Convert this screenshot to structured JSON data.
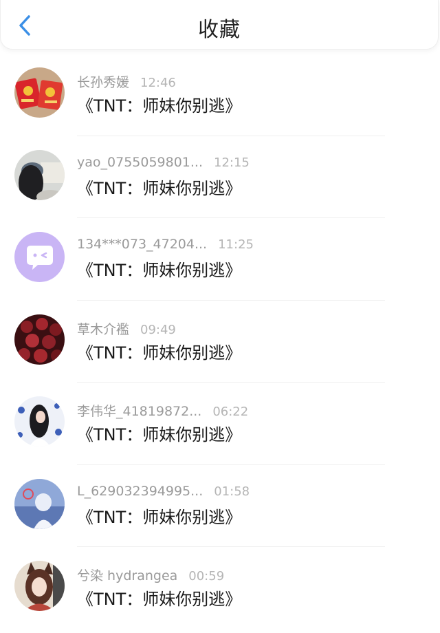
{
  "header": {
    "title": "收藏",
    "back_icon": "chevron-left-icon",
    "accent": "#3b8fe6"
  },
  "items": [
    {
      "name": "长孙秀媛",
      "time": "12:46",
      "message": "《TNT：师妹你别逃》",
      "avatar": "red-envelope-avatar"
    },
    {
      "name": "yao_0755059801...",
      "time": "12:15",
      "message": "《TNT：师妹你别逃》",
      "avatar": "girl-photo-avatar"
    },
    {
      "name": "134***073_47204...",
      "time": "11:25",
      "message": "《TNT：师妹你别逃》",
      "avatar": "default-chat-avatar"
    },
    {
      "name": "草木介襤",
      "time": "09:49",
      "message": "《TNT：师妹你别逃》",
      "avatar": "roses-avatar"
    },
    {
      "name": "李伟华_41819872...",
      "time": "06:22",
      "message": "《TNT：师妹你别逃》",
      "avatar": "portrait-avatar"
    },
    {
      "name": "L_629032394995...",
      "time": "01:58",
      "message": "《TNT：师妹你别逃》",
      "avatar": "anime-blue-avatar"
    },
    {
      "name": "兮染 hydrangea",
      "time": "00:59",
      "message": "《TNT：师妹你别逃》",
      "avatar": "anime-foxgirl-avatar"
    }
  ]
}
